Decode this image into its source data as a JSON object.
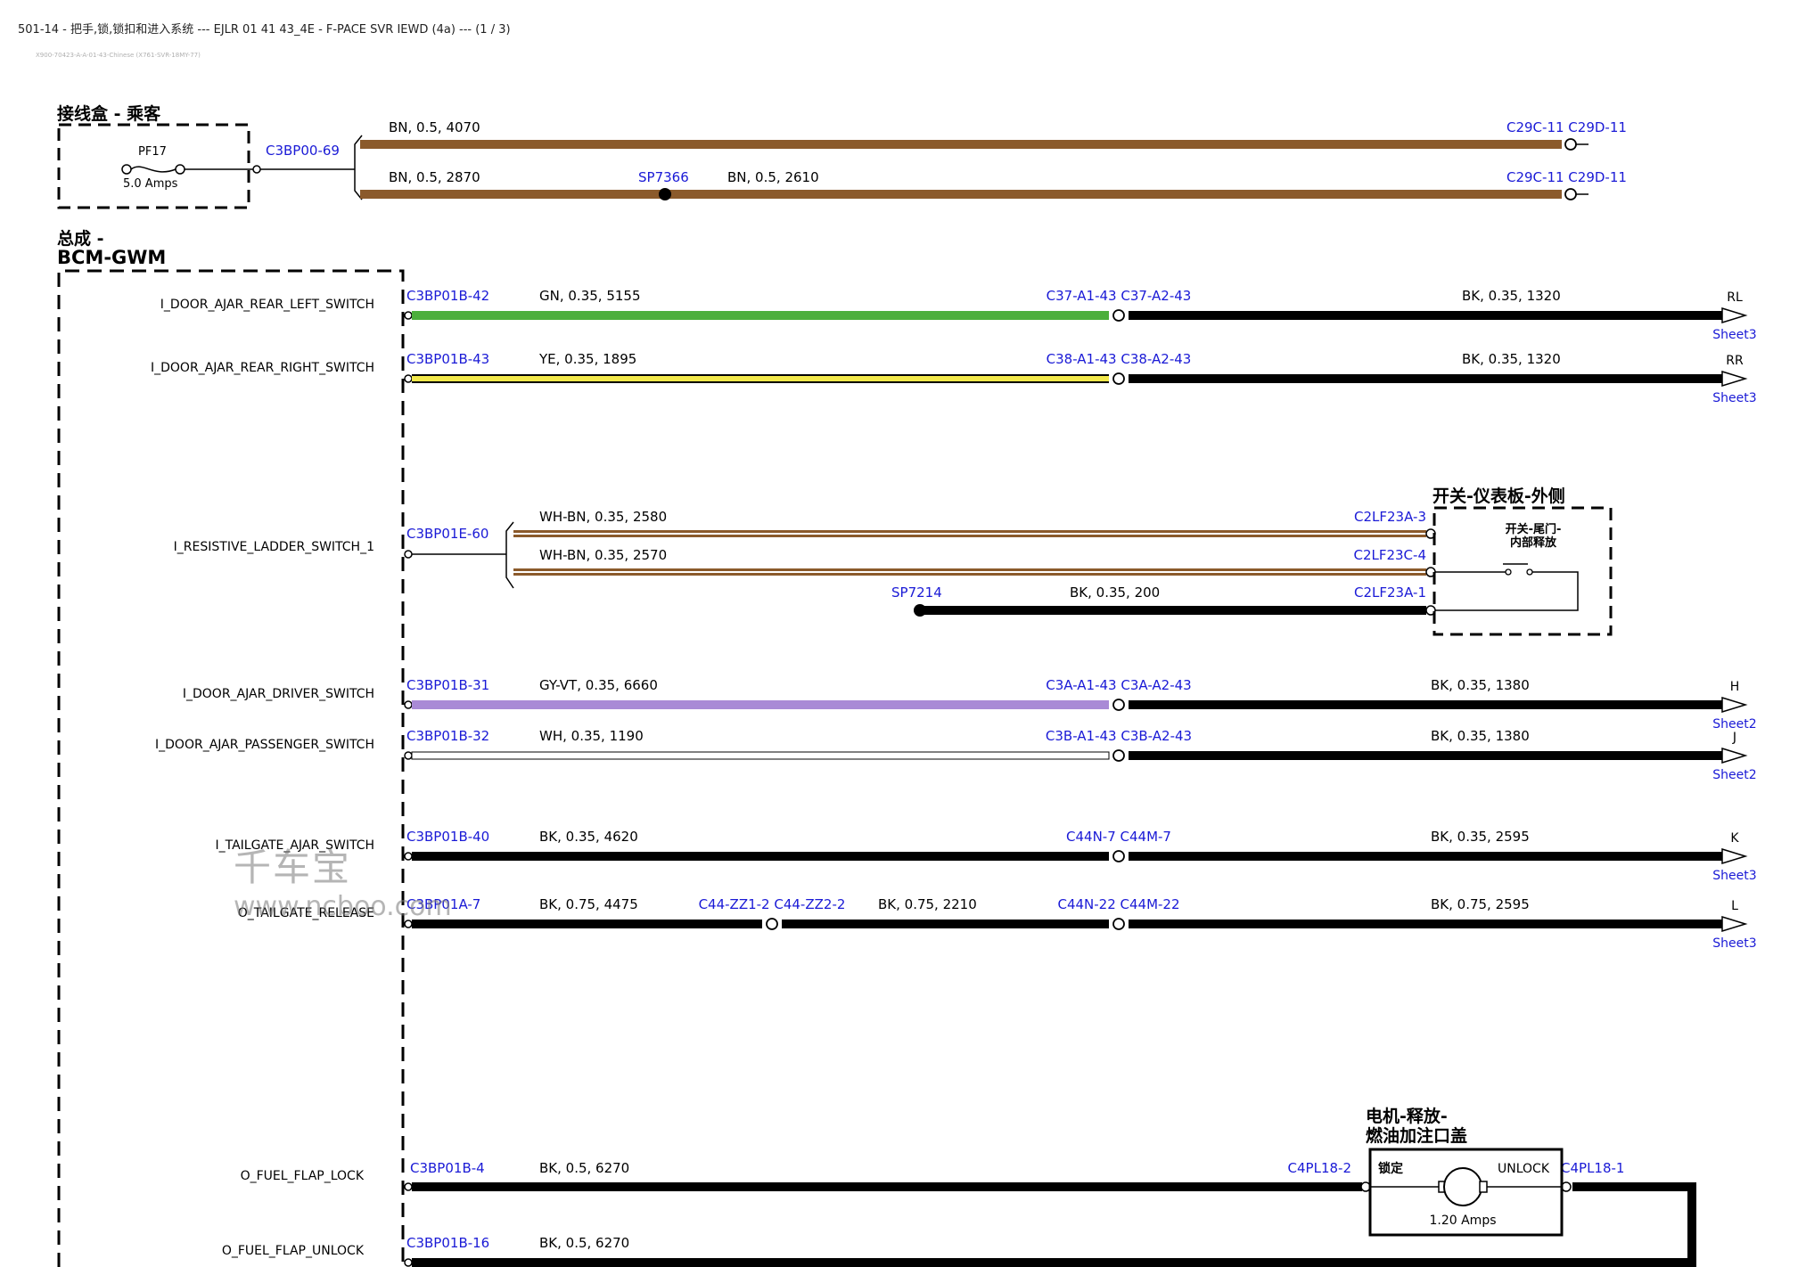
{
  "header": {
    "title": "501-14 - 把手,锁,锁扣和进入系统 --- EJLR 01 41 43_4E - F-PACE SVR IEWD (4a) --- (1 / 3)",
    "doc_ref": "X900-70423-A-A-01-43-Chinese (X761-SVR-18MY-77)"
  },
  "watermark": {
    "name": "千车宝",
    "url": "www.ncboo.com"
  },
  "colors": {
    "BN": "#8b5a2b",
    "GN": "#4caf3c",
    "YE": "#f2e84a",
    "GY-VT": "#a98ad6",
    "WH": "#ffffff",
    "BK": "#000000",
    "WH-BN": "#8b5a2b",
    "connector_label": "#1a1ad6"
  },
  "components": {
    "junction_box": {
      "title": "接线盒 - 乘客",
      "fuse_id": "PF17",
      "fuse_rating": "5.0 Amps",
      "connector": "C3BP00-69"
    },
    "bcm": {
      "title_line1": "总成 -",
      "title_line2": "BCM-GWM"
    },
    "switch": {
      "title": "开关-仪表板-外侧",
      "inner_line1": "开关-尾门-",
      "inner_line2": "内部释放"
    },
    "motor": {
      "title_line1": "电机-释放-",
      "title_line2": "燃油加注口盖",
      "lock_label": "锁定",
      "unlock_label": "UNLOCK",
      "rating": "1.20 Amps"
    }
  },
  "junction_wires": [
    {
      "spec": "BN,  0.5,  4070",
      "end_label": "C29C-11  C29D-11",
      "splice": "",
      "spec2": ""
    },
    {
      "spec": "BN,  0.5,  2870",
      "end_label": "C29C-11  C29D-11",
      "splice": "SP7366",
      "spec2": "BN,  0.5,  2610"
    }
  ],
  "circuits": [
    {
      "signal": "I_DOOR_AJAR_REAR_LEFT_SWITCH",
      "pin": "C3BP01B-42",
      "wire1": "GN,  0.35,  5155",
      "color1": "GN",
      "conn_mid": "C37-A1-43  C37-A2-43",
      "wire2": "BK,  0.35,  1320",
      "end_code": "RL",
      "sheet": "Sheet3"
    },
    {
      "signal": "I_DOOR_AJAR_REAR_RIGHT_SWITCH",
      "pin": "C3BP01B-43",
      "wire1": "YE,  0.35,  1895",
      "color1": "YE",
      "conn_mid": "C38-A1-43  C38-A2-43",
      "wire2": "BK,  0.35,  1320",
      "end_code": "RR",
      "sheet": "Sheet3"
    },
    {
      "signal": "I_DOOR_AJAR_DRIVER_SWITCH",
      "pin": "C3BP01B-31",
      "wire1": "GY-VT,  0.35,  6660",
      "color1": "GY-VT",
      "conn_mid": "C3A-A1-43  C3A-A2-43",
      "wire2": "BK,  0.35,  1380",
      "end_code": "H",
      "sheet": "Sheet2"
    },
    {
      "signal": "I_DOOR_AJAR_PASSENGER_SWITCH",
      "pin": "C3BP01B-32",
      "wire1": "WH,  0.35,  1190",
      "color1": "WH",
      "conn_mid": "C3B-A1-43  C3B-A2-43",
      "wire2": "BK,  0.35,  1380",
      "end_code": "J",
      "sheet": "Sheet2"
    },
    {
      "signal": "I_TAILGATE_AJAR_SWITCH",
      "pin": "C3BP01B-40",
      "wire1": "BK,  0.35,  4620",
      "color1": "BK",
      "conn_mid": "C44N-7  C44M-7",
      "wire2": "BK,  0.35,  2595",
      "end_code": "K",
      "sheet": "Sheet3"
    }
  ],
  "tailgate_release": {
    "signal": "O_TAILGATE_RELEASE",
    "pin": "C3BP01A-7",
    "wire1": "BK,  0.75,  4475",
    "conn1": "C44-ZZ1-2  C44-ZZ2-2",
    "wire2": "BK,  0.75,  2210",
    "conn2": "C44N-22  C44M-22",
    "wire3": "BK,  0.75,  2595",
    "end_code": "L",
    "sheet": "Sheet3"
  },
  "resistive_ladder": {
    "signal": "I_RESISTIVE_LADDER_SWITCH_1",
    "pin": "C3BP01E-60",
    "wires": [
      {
        "spec": "WH-BN,  0.35,  2580",
        "end": "C2LF23A-3"
      },
      {
        "spec": "WH-BN,  0.35,  2570",
        "end": "C2LF23C-4"
      }
    ],
    "ground": {
      "splice": "SP7214",
      "spec": "BK,  0.35,  200",
      "end": "C2LF23A-1"
    }
  },
  "fuel_flap": [
    {
      "signal": "O_FUEL_FLAP_LOCK",
      "pin": "C3BP01B-4",
      "wire": "BK,  0.5,  6270",
      "motor_pin": "C4PL18-2"
    },
    {
      "signal": "O_FUEL_FLAP_UNLOCK",
      "pin": "C3BP01B-16",
      "wire": "BK,  0.5,  6270",
      "motor_pin": "C4PL18-1"
    }
  ]
}
